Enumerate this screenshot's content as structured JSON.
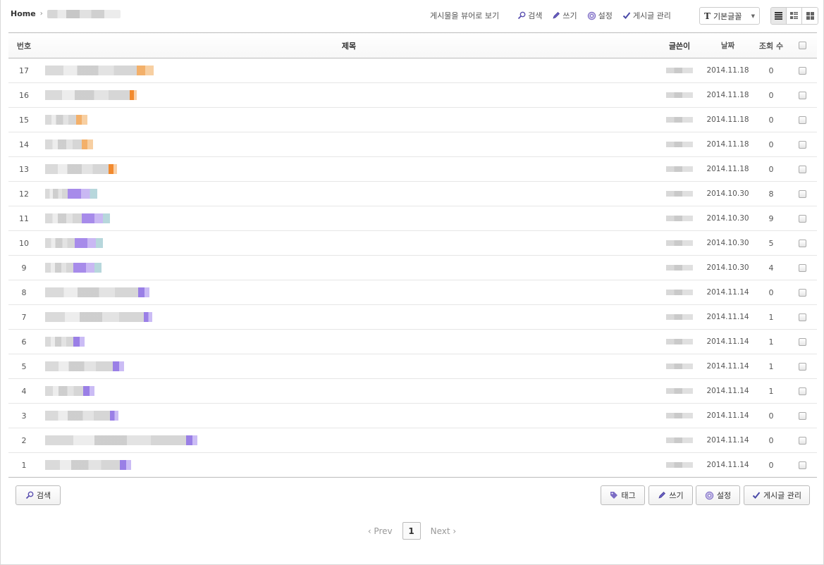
{
  "breadcrumb": {
    "home": "Home"
  },
  "top_actions": {
    "view_as_webzine": "게시물을 뷰어로 보기",
    "search": "검색",
    "write": "쓰기",
    "settings": "설정",
    "manage": "게시글 관리"
  },
  "font_select": {
    "icon": "T",
    "value": "기본글꼴"
  },
  "table": {
    "headers": {
      "no": "번호",
      "title": "제목",
      "author": "글쓴이",
      "date": "날짜",
      "views": "조회 수"
    },
    "rows": [
      {
        "no": "17",
        "date": "2014.11.18",
        "views": "0"
      },
      {
        "no": "16",
        "date": "2014.11.18",
        "views": "0"
      },
      {
        "no": "15",
        "date": "2014.11.18",
        "views": "0"
      },
      {
        "no": "14",
        "date": "2014.11.18",
        "views": "0"
      },
      {
        "no": "13",
        "date": "2014.11.18",
        "views": "0"
      },
      {
        "no": "12",
        "date": "2014.10.30",
        "views": "8"
      },
      {
        "no": "11",
        "date": "2014.10.30",
        "views": "9"
      },
      {
        "no": "10",
        "date": "2014.10.30",
        "views": "5"
      },
      {
        "no": "9",
        "date": "2014.10.30",
        "views": "4"
      },
      {
        "no": "8",
        "date": "2014.11.14",
        "views": "0"
      },
      {
        "no": "7",
        "date": "2014.11.14",
        "views": "1"
      },
      {
        "no": "6",
        "date": "2014.11.14",
        "views": "1"
      },
      {
        "no": "5",
        "date": "2014.11.14",
        "views": "1"
      },
      {
        "no": "4",
        "date": "2014.11.14",
        "views": "1"
      },
      {
        "no": "3",
        "date": "2014.11.14",
        "views": "0"
      },
      {
        "no": "2",
        "date": "2014.11.14",
        "views": "0"
      },
      {
        "no": "1",
        "date": "2014.11.14",
        "views": "0"
      }
    ]
  },
  "footer": {
    "search": "검색",
    "tag": "태그",
    "write": "쓰기",
    "settings": "설정",
    "manage": "게시글 관리"
  },
  "pagination": {
    "prev": "‹ Prev",
    "current": "1",
    "next": "Next ›"
  },
  "colors": {
    "accent_icon": "#5a4fb0",
    "border": "#bbbbbb",
    "text": "#555555"
  }
}
